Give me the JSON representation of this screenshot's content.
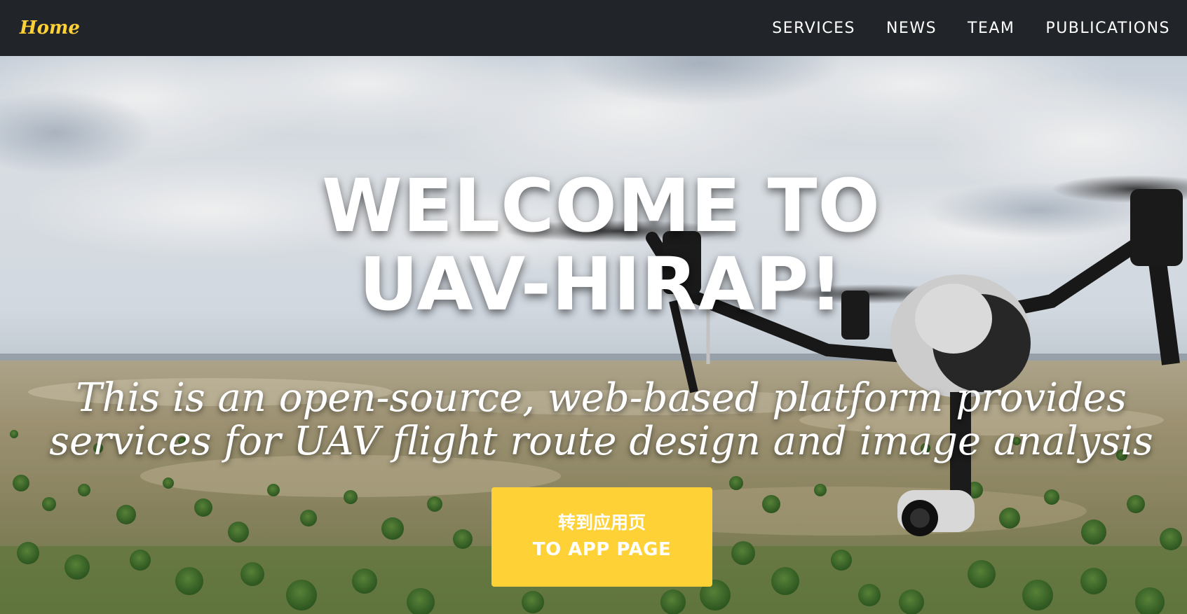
{
  "nav": {
    "brand": "Home",
    "links": [
      "SERVICES",
      "NEWS",
      "TEAM",
      "PUBLICATIONS"
    ]
  },
  "hero": {
    "title_line1": "WELCOME TO",
    "title_line2": "UAV-HIRAP!",
    "subtitle_line1": "This is an open-source, web-based platform provides",
    "subtitle_line2": "services for UAV flight route design and image analysis",
    "cta_line1": "转到应用页",
    "cta_line2": "TO APP PAGE",
    "background_image": "drone-over-grassland-photo"
  },
  "colors": {
    "navbar": "#212529",
    "accent": "#fed136",
    "text": "#ffffff"
  }
}
